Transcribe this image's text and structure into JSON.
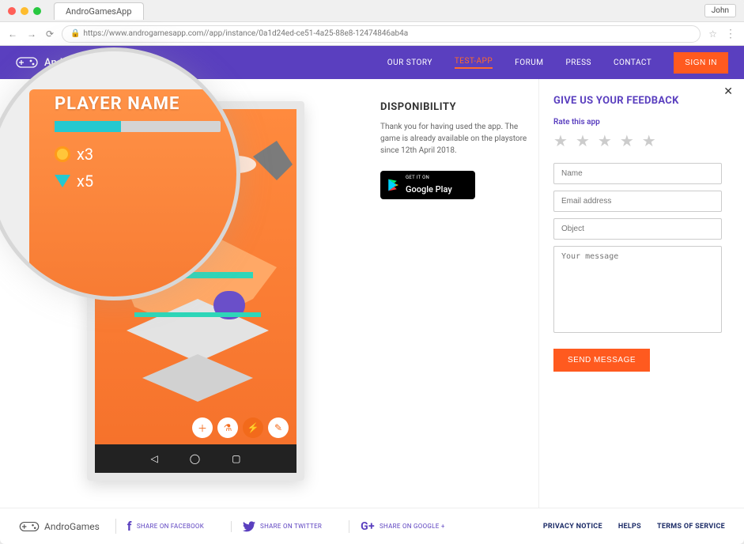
{
  "browser": {
    "tab_title": "AndroGamesApp",
    "url": "https://www.androgamesapp.com//app/instance/0a1d24ed-ce51-4a25-88e8-12474846ab4a",
    "user_chip": "John"
  },
  "header": {
    "brand": "AndroG",
    "nav": {
      "our_story": "OUR STORY",
      "test_app": "TEST-APP",
      "forum": "FORUM",
      "press": "PRESS",
      "contact": "CONTACT"
    },
    "signin": "SIGN IN"
  },
  "game_hud": {
    "player_name_label": "PLAYER NAME",
    "coins": "x3",
    "gems": "x5"
  },
  "disponibility": {
    "title": "DISPONIBILITY",
    "body": "Thank you for having used the app. The game is already available on the playstore since 12th April 2018.",
    "gplay_small": "GET IT ON",
    "gplay_big": "Google Play"
  },
  "feedback": {
    "title": "GIVE US YOUR FEEDBACK",
    "rate_label": "Rate this app",
    "name_ph": "Name",
    "email_ph": "Email address",
    "object_ph": "Object",
    "message_ph": "Your message",
    "send": "SEND MESSAGE"
  },
  "footer": {
    "brand": "AndroGames",
    "share_fb": "SHARE ON FACEBOOK",
    "share_tw": "SHARE ON TWITTER",
    "share_gp": "SHARE ON GOOGLE +",
    "privacy": "PRIVACY NOTICE",
    "helps": "HELPS",
    "terms": "TERMS OF SERVICE"
  }
}
